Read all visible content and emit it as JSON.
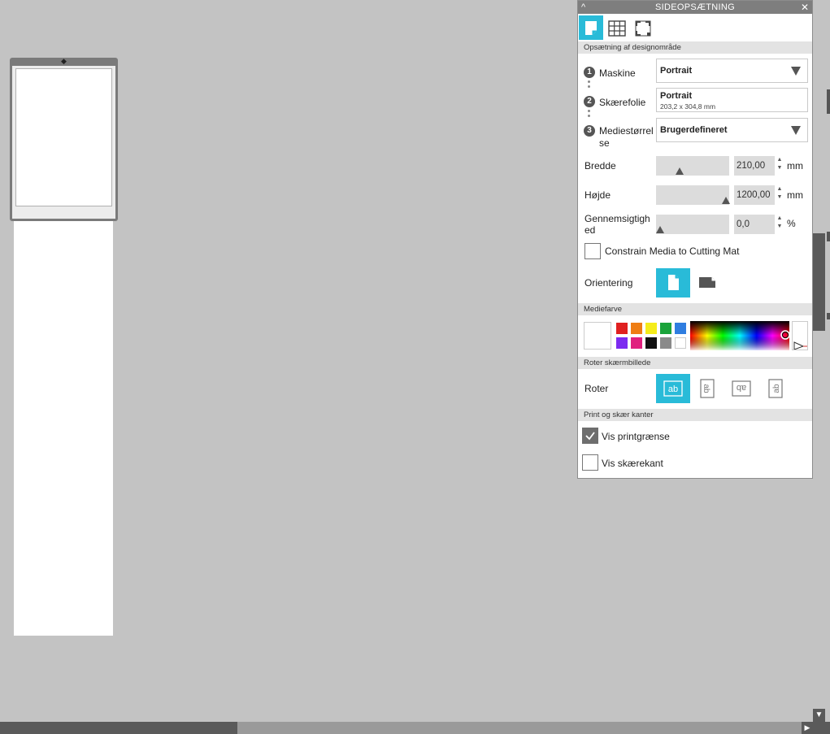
{
  "panel": {
    "title": "SIDEOPSÆTNING",
    "collapse_glyph": "^",
    "close_glyph": "✕",
    "tabs": [
      {
        "name": "media-tab",
        "icon": "page-icon",
        "active": true
      },
      {
        "name": "grid-tab",
        "icon": "grid-icon",
        "active": false
      },
      {
        "name": "registration-tab",
        "icon": "registration-marks-icon",
        "active": false
      }
    ],
    "design_area": {
      "header": "Opsætning af designområde",
      "step1": "1",
      "step2": "2",
      "step3": "3",
      "machine_label": "Maskine",
      "machine_value": "Portrait",
      "cutting_mat_label": "Skærefolie",
      "cutting_mat_value": "Portrait",
      "cutting_mat_size": "203,2 x 304,8 mm",
      "media_size_label_1": "Mediestørrel",
      "media_size_label_2": "se",
      "media_size_value": "Brugerdefineret",
      "width_label": "Bredde",
      "width_value": "210,00",
      "width_unit": "mm",
      "height_label": "Højde",
      "height_value": "1200,00",
      "height_unit": "mm",
      "transparency_label_1": "Gennemsigtigh",
      "transparency_label_2": "ed",
      "transparency_value": "0,0",
      "transparency_unit": "%",
      "constrain_label": "Constrain Media to Cutting Mat",
      "constrain_checked": false,
      "orientation_label": "Orientering",
      "orientation_selected": "portrait"
    },
    "media_color": {
      "header": "Mediefarve",
      "swatches_row1": [
        "#e02020",
        "#ef7d14",
        "#f5ec1b",
        "#1aa33a",
        "#2f7de0"
      ],
      "swatches_row2": [
        "#7c2bf0",
        "#e0207e",
        "#111111",
        "#8a8a8a",
        "#ffffff"
      ],
      "selected_color": "#ffffff"
    },
    "rotate_view": {
      "header": "Roter skærmbillede",
      "label": "Roter",
      "option_glyph": "ab",
      "options": [
        "0",
        "90",
        "180",
        "270"
      ],
      "selected": "0"
    },
    "print_cut": {
      "header": "Print og skær kanter",
      "show_print_border_label": "Vis printgrænse",
      "show_print_border_checked": true,
      "show_cut_border_label": "Vis skærekant",
      "show_cut_border_checked": false
    }
  },
  "canvas": {
    "scroll_right_glyph": "▶",
    "scroll_down_glyph": "▼",
    "mat_marker_glyph": "◆"
  },
  "colors": {
    "accent": "#29bbd8",
    "background": "#c3c3c3",
    "title_bar": "#7e7e7e"
  }
}
